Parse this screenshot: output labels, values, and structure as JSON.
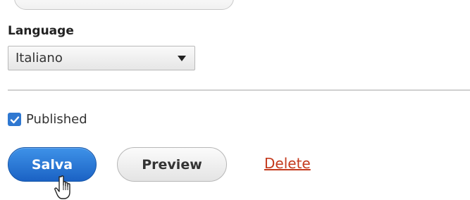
{
  "language": {
    "label": "Language",
    "selected": "Italiano"
  },
  "published": {
    "label": "Published",
    "checked": true
  },
  "actions": {
    "save_label": "Salva",
    "preview_label": "Preview",
    "delete_label": "Delete"
  },
  "colors": {
    "primary": "#1b62c4",
    "checkbox": "#2f78d1",
    "danger_link": "#c43a1d",
    "divider": "#d0d0d0"
  },
  "icons": {
    "select_caret": "caret-down-icon",
    "checkbox_mark": "checkmark-icon",
    "pointer": "hand-pointer-icon"
  }
}
